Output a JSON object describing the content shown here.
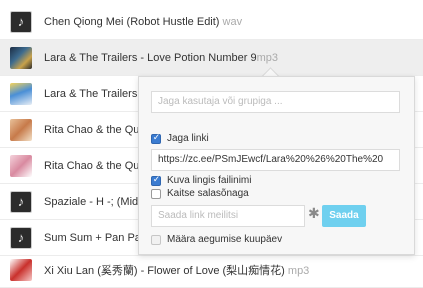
{
  "tracks": [
    {
      "title": "Chen Qiong Mei (Robot Hustle Edit)",
      "ext": "wav"
    },
    {
      "title": "Lara & The Trailers - Love Potion Number 9",
      "ext": "mp3"
    },
    {
      "title": "Lara & The Trailers -",
      "ext": ""
    },
    {
      "title": "Rita Chao & the Que",
      "ext": ""
    },
    {
      "title": "Rita Chao & the Que",
      "ext": ""
    },
    {
      "title": "Spaziale - H -; (Midn",
      "ext": ""
    },
    {
      "title": "Sum Sum + Pan Par",
      "ext": ""
    },
    {
      "title": "Xi Xiu Lan (奚秀蘭) - Flower of Love (梨山痴情花)",
      "ext": "mp3"
    }
  ],
  "share": {
    "user_group_placeholder": "Jaga kasutaja või grupiga ...",
    "share_link_label": "Jaga linki",
    "share_link_checked": true,
    "link_url": "https://zc.ee/PSmJEwcf/Lara%20%26%20The%20",
    "show_file_list_label": "Kuva lingis failinimi",
    "show_file_list_checked": true,
    "password_label": "Kaitse salasõnaga",
    "password_checked": false,
    "email_placeholder": "Saada link meilitsi",
    "asterisk": "✱",
    "send_label": "Saada",
    "expiry_label": "Määra aegumise kuupäev",
    "expiry_checked": false
  }
}
